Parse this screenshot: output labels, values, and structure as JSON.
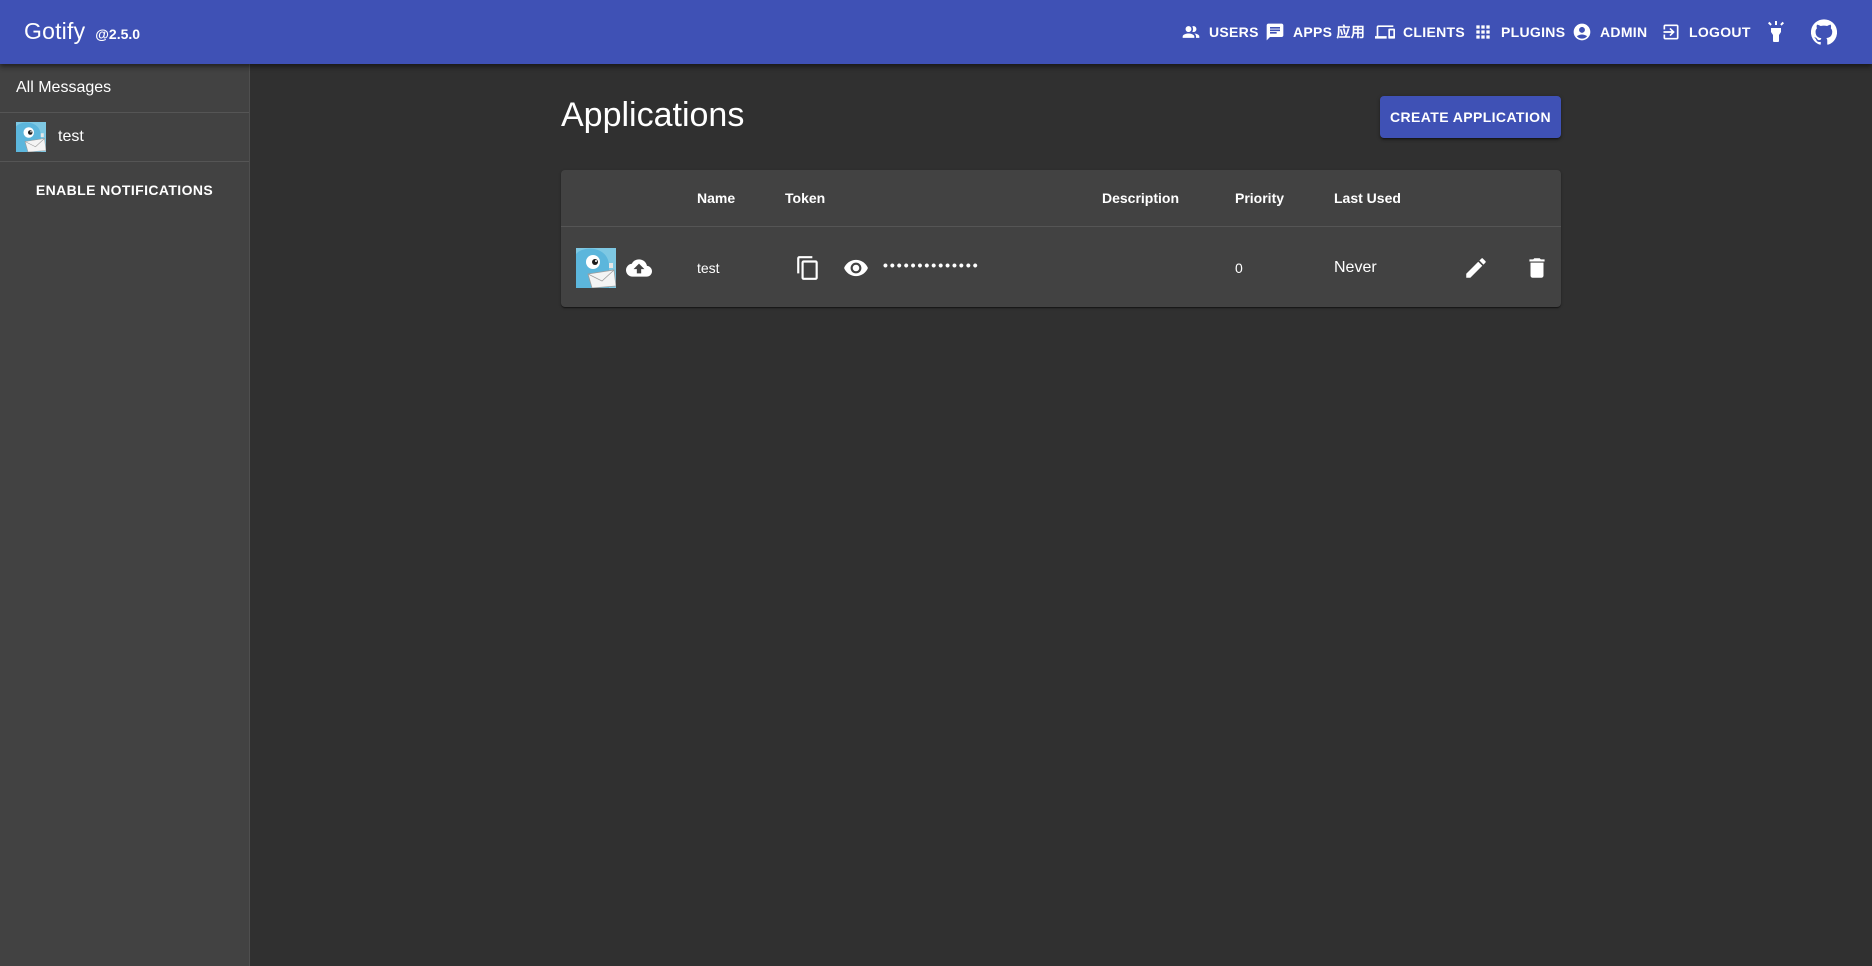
{
  "app": {
    "name": "Gotify",
    "version": "@2.5.0"
  },
  "nav": {
    "users": "USERS",
    "apps": "APPS 应用",
    "clients": "CLIENTS",
    "plugins": "PLUGINS",
    "admin": "ADMIN",
    "logout": "LOGOUT",
    "theme_icon": "lightbulb-icon",
    "github_icon": "github-icon"
  },
  "sidebar": {
    "all_messages": "All Messages",
    "apps": [
      {
        "name": "test",
        "icon": "gopher-avatar"
      }
    ],
    "enable_notifications": "ENABLE NOTIFICATIONS"
  },
  "page": {
    "title": "Applications",
    "create_button": "CREATE APPLICATION"
  },
  "table": {
    "columns": [
      "",
      "Name",
      "Token",
      "Description",
      "Priority",
      "Last Used"
    ],
    "rows": [
      {
        "name": "test",
        "token_masked": "••••••••••••••",
        "description": "",
        "priority": "0",
        "last_used": "Never"
      }
    ]
  },
  "colors": {
    "primary": "#3f51b5",
    "background": "#303030",
    "paper": "#424242"
  }
}
